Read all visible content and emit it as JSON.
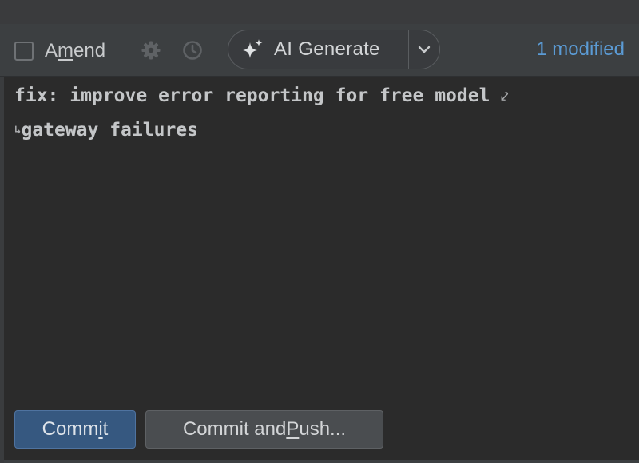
{
  "toolbar": {
    "amend": {
      "pre": "A",
      "mnemonic": "m",
      "post": "end",
      "checked": false
    },
    "settings_icon": "gear-icon",
    "history_icon": "clock-icon",
    "ai_generate": {
      "label": "AI Generate",
      "icon": "sparkle-icon",
      "dropdown_icon": "chevron-down-icon"
    },
    "modified_label": "1 modified"
  },
  "editor": {
    "line1": "fix: improve error reporting for free model",
    "line2": "gateway failures",
    "wrap_end_glyph": "⤦",
    "wrap_start_glyph": "↳"
  },
  "buttons": {
    "commit": {
      "pre": "Comm",
      "mnemonic": "i",
      "post": "t"
    },
    "commit_push": {
      "pre": "Commit and ",
      "mnemonic": "P",
      "post": "ush..."
    }
  },
  "colors": {
    "background": "#2b2b2b",
    "toolbar": "#3c3f41",
    "accent_link": "#5b9bd5",
    "primary_button": "#365880"
  }
}
